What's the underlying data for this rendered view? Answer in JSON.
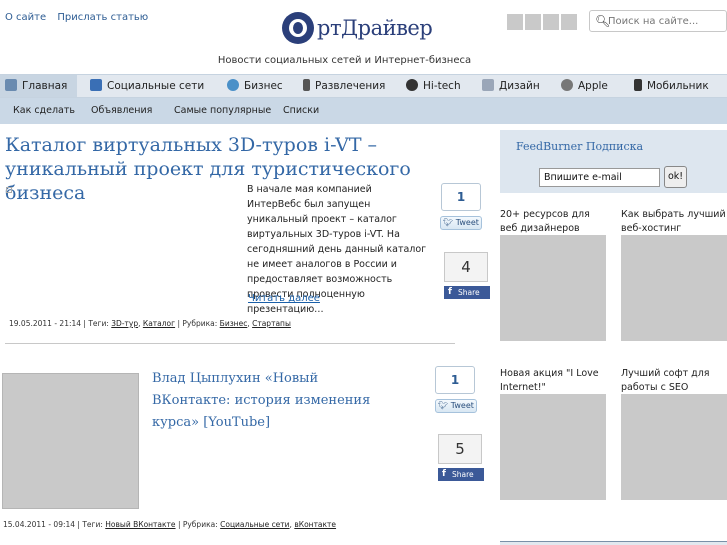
{
  "top_links": [
    "О сайте",
    "Прислать статью"
  ],
  "logo": {
    "text": "ртДрайвер"
  },
  "tagline": "Новости социальных сетей и Интернет-бизнеса",
  "search": {
    "placeholder": "Поиск на сайте..."
  },
  "main_nav": [
    {
      "label": "Главная",
      "icon": "home-icon",
      "color": "#6a8bb0",
      "active": true
    },
    {
      "label": "Социальные сети",
      "icon": "social-icon",
      "color": "#3a6fb5"
    },
    {
      "label": "Бизнес",
      "icon": "globe-icon",
      "color": "#4a90c8"
    },
    {
      "label": "Развлечения",
      "icon": "mic-icon",
      "color": "#555555"
    },
    {
      "label": "Hi-tech",
      "icon": "power-icon",
      "color": "#333333"
    },
    {
      "label": "Дизайн",
      "icon": "pencil-icon",
      "color": "#9aa6b8"
    },
    {
      "label": "Apple",
      "icon": "apple-icon",
      "color": "#777777"
    },
    {
      "label": "Мобильник",
      "icon": "phone-icon",
      "color": "#333333"
    }
  ],
  "sub_nav": [
    "Как сделать",
    "Объявления",
    "Самые популярные",
    "Списки"
  ],
  "posts": [
    {
      "title": "Каталог виртуальных 3D-туров i-VT – уникальный проект для туристического бизнеса",
      "excerpt": "В начале мая компанией ИнтерВебс был запущен уникальный проект – каталог виртуальных 3D-туров i-VT. На сегодняшний день данный каталог не имеет аналогов в России и предоставляет возможность провести полноценную презентацию…",
      "more": "Читать далее",
      "tweet_count": "1",
      "tweet_label": "Tweet",
      "share_count": "4",
      "share_label": "Share",
      "meta_prefix": "19.05.2011 - 21:14 | Теги:",
      "tags": [
        "3D-тур",
        "Каталог"
      ],
      "rubric_prefix": "| Рубрика:",
      "rubrics": [
        "Бизнес",
        "Стартапы"
      ]
    },
    {
      "title": "Влад Цыплухин «Новый ВКонтакте: история изменения курса» [YouTube]",
      "tweet_count": "1",
      "tweet_label": "Tweet",
      "share_count": "5",
      "share_label": "Share",
      "meta_prefix": "15.04.2011 - 09:14 | Теги:",
      "tags": [
        "Новый ВКонтакте"
      ],
      "rubric_prefix": "| Рубрика:",
      "rubrics": [
        "Социальные сети",
        "вКонтакте"
      ]
    }
  ],
  "feedburner": {
    "title": "FeedBurner Подписка",
    "email_value": "Впишите e-mail",
    "ok_label": "ok!"
  },
  "sidebar_cards": [
    {
      "title": "20+ ресурсов для веб дизайнеров"
    },
    {
      "title": "Как выбрать лучший веб-хостинг"
    },
    {
      "title": "Новая акция \"I Love Internet!\""
    },
    {
      "title": "Лучший софт для работы с SEO"
    }
  ]
}
